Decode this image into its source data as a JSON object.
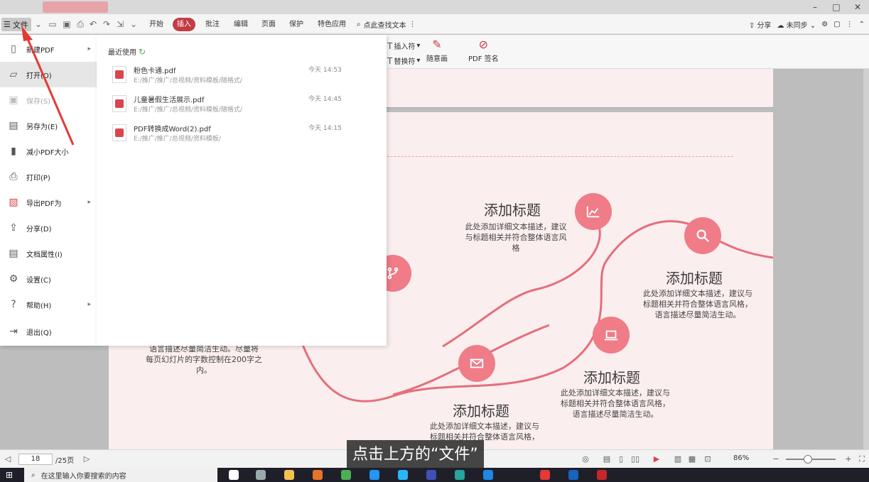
{
  "menubar": {
    "file_label": "文件",
    "tabs": [
      "开始",
      "插入",
      "批注",
      "编辑",
      "页面",
      "保护",
      "特色应用"
    ],
    "active_tab": "插入",
    "search_label": "点此查找文本",
    "share_label": "分享",
    "sync_label": "未同步"
  },
  "ribbon": {
    "insert_symbol": "插入符",
    "replace_symbol": "替换符",
    "freehand": "随意画",
    "pdf_sign": "PDF 签名"
  },
  "file_menu": {
    "items": [
      {
        "label": "新建PDF",
        "icon": "new-doc-icon",
        "has_submenu": true
      },
      {
        "label": "打开(O)",
        "icon": "folder-open-icon",
        "selected": true
      },
      {
        "label": "保存(S)",
        "icon": "save-icon",
        "disabled": true
      },
      {
        "label": "另存为(E)",
        "icon": "save-as-icon"
      },
      {
        "label": "减小PDF大小",
        "icon": "compress-icon"
      },
      {
        "label": "打印(P)",
        "icon": "printer-icon"
      },
      {
        "label": "导出PDF为",
        "icon": "export-icon",
        "has_submenu": true
      },
      {
        "label": "分享(D)",
        "icon": "share-icon"
      },
      {
        "label": "文档属性(I)",
        "icon": "doc-properties-icon"
      },
      {
        "label": "设置(C)",
        "icon": "gear-icon"
      },
      {
        "label": "帮助(H)",
        "icon": "help-icon",
        "has_submenu": true
      },
      {
        "label": "退出(Q)",
        "icon": "exit-icon"
      }
    ]
  },
  "recent": {
    "heading": "最近使用",
    "files": [
      {
        "name": "粉色卡通.pdf",
        "path": "E:/推广/推广/总视频/资料模板/随格式/",
        "time": "今天 14:53"
      },
      {
        "name": "儿童暑假生活展示.pdf",
        "path": "E:/推广/推广/总视频/资料模板/随格式/",
        "time": "今天 14:45"
      },
      {
        "name": "PDF转换成Word(2).pdf",
        "path": "E:/推广/推广/总视频/资料模板/",
        "time": "今天 14:15"
      }
    ]
  },
  "document": {
    "blocks": [
      {
        "title": "添加标题",
        "text": "此处添加详细文本描述，建议与标题相关并符合整体语言风格"
      },
      {
        "title": "添加标题",
        "text": "此处添加详细文本描述，建议与标题相关并符合整体语言风格，语言描述尽量简洁生动。"
      },
      {
        "title": "添加标题",
        "text": "此处添加详细文本描述，建议与标题相关并符合整体语言风格，语言描述尽量简洁生动。"
      },
      {
        "title": "添加标题",
        "text": "此处添加详细文本描述，建议与标题相关并符合整体语言风格，"
      }
    ],
    "left_text": "语言描述尽量简洁生动。尽量将每页幻灯片的字数控制在200字之内。"
  },
  "statusbar": {
    "page_current": "18",
    "page_total": "/25页",
    "zoom": "86%"
  },
  "subtitle": "点击上方的“文件”",
  "taskbar": {
    "search_placeholder": "在这里输入你要搜索的内容"
  },
  "colors": {
    "accent_red": "#c33c45",
    "node_pink": "#ef7c87",
    "page_bg": "#fbeeee"
  }
}
